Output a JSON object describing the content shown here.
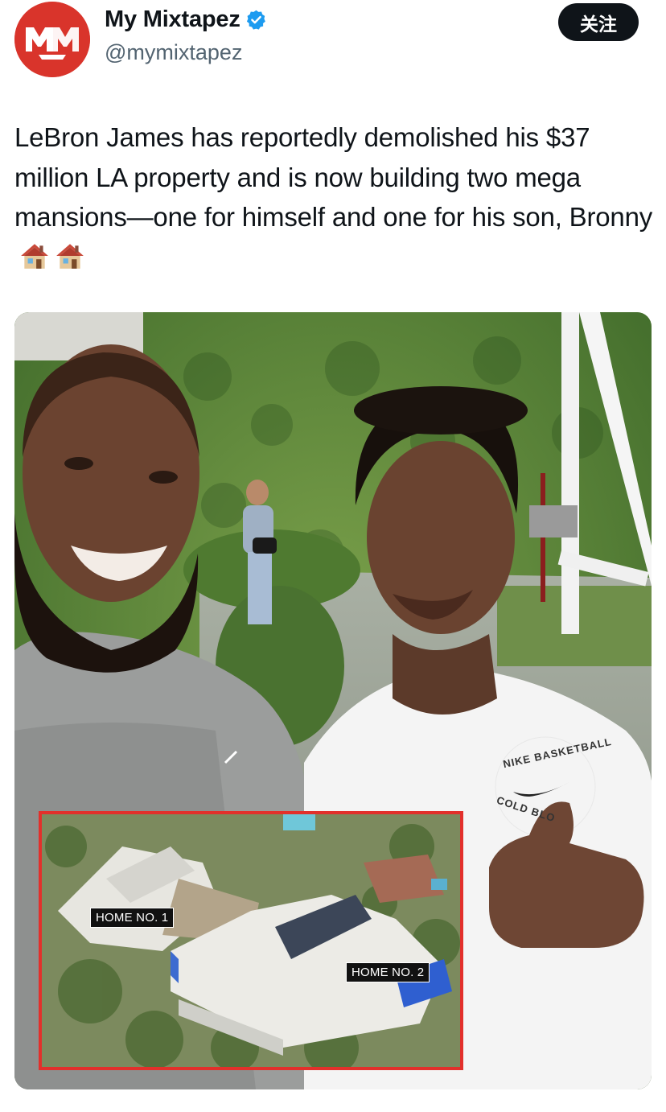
{
  "account": {
    "display_name": "My Mixtapez",
    "handle": "@mymixtapez",
    "avatar_text": "MM",
    "verified": true
  },
  "follow_button": "关注",
  "tweet": {
    "text": "LeBron James has reportedly demolished his $37 million LA property and is now building two mega mansions—one for himself and one for his son, Bronny",
    "emojis": [
      "house-icon",
      "house-icon"
    ]
  },
  "media": {
    "inset_labels": {
      "home1": "HOME NO. 1",
      "home2": "HOME NO. 2"
    },
    "shirt_print": {
      "top": "NIKE BASKETBALL",
      "bottom": "COLD BLO"
    }
  },
  "colors": {
    "avatar_red": "#d9342b",
    "verified_blue": "#1d9bf0",
    "inset_border": "#e2302b"
  }
}
